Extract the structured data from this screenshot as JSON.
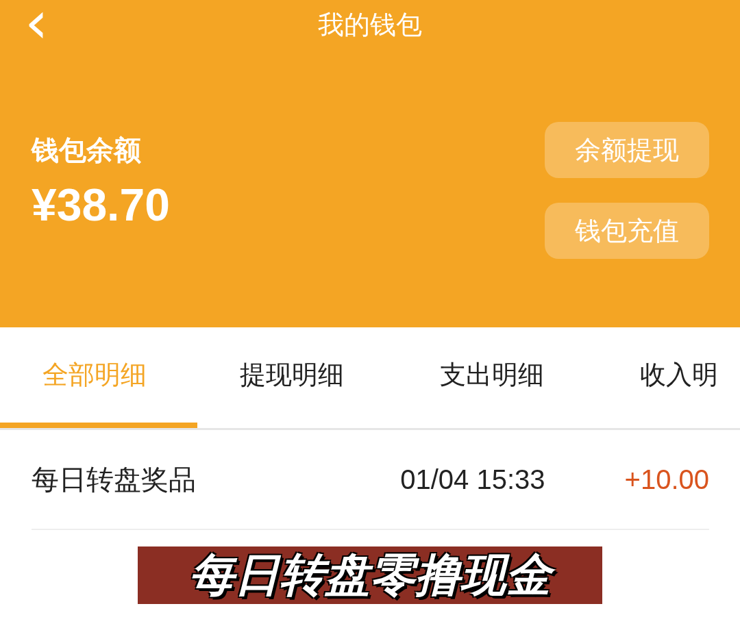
{
  "header": {
    "back": "‹",
    "title": "我的钱包"
  },
  "balance": {
    "label": "钱包余额",
    "amount": "¥38.70"
  },
  "actions": [
    "余额提现",
    "钱包充值"
  ],
  "tabs": [
    {
      "label": "全部明细",
      "selected": true
    },
    {
      "label": "提现明细",
      "selected": false
    },
    {
      "label": "支出明细",
      "selected": false
    },
    {
      "label": "收入明",
      "selected": false
    }
  ],
  "transactions": [
    {
      "title": "每日转盘奖品",
      "time": "01/04 15:33",
      "amount": "+10.00"
    }
  ],
  "caption": "每日转盘零撸现金"
}
